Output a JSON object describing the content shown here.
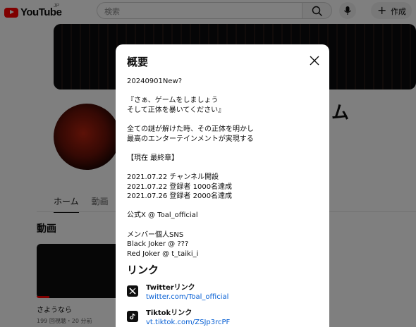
{
  "header": {
    "logo_text": "YouTube",
    "logo_region": "JP",
    "search_placeholder": "検索",
    "create_label": "作成"
  },
  "channel": {
    "name_fragment": "ム",
    "tabs": [
      "ホーム",
      "動画"
    ]
  },
  "section": {
    "title": "動画",
    "video": {
      "title": "さようなら",
      "meta": "199 回視聴・20 分前"
    }
  },
  "modal": {
    "title": "概要",
    "description_lines": [
      "20240901New?",
      "",
      "『さぁ、ゲームをしましょう",
      "そして正体を暴いてください』",
      "",
      "全ての謎が解けた時、その正体を明かし",
      "最高のエンターテインメントが実現する",
      "",
      "【現在 最終章】",
      "",
      "2021.07.22 チャンネル開設",
      "2021.07.22 登録者 1000名達成",
      "2021.07.26 登録者 2000名達成",
      "",
      "公式X @ Toal_official",
      "",
      "メンバー個人SNS",
      "Black Joker @ ???",
      "Red Joker @ t_taiki_i"
    ],
    "links_title": "リンク",
    "links": [
      {
        "name": "Twitterリンク",
        "url": "twitter.com/Toal_official",
        "icon": "x-logo-icon"
      },
      {
        "name": "Tiktokリンク",
        "url": "vt.tiktok.com/ZSJp3rcPF",
        "icon": "tiktok-logo-icon"
      }
    ]
  }
}
